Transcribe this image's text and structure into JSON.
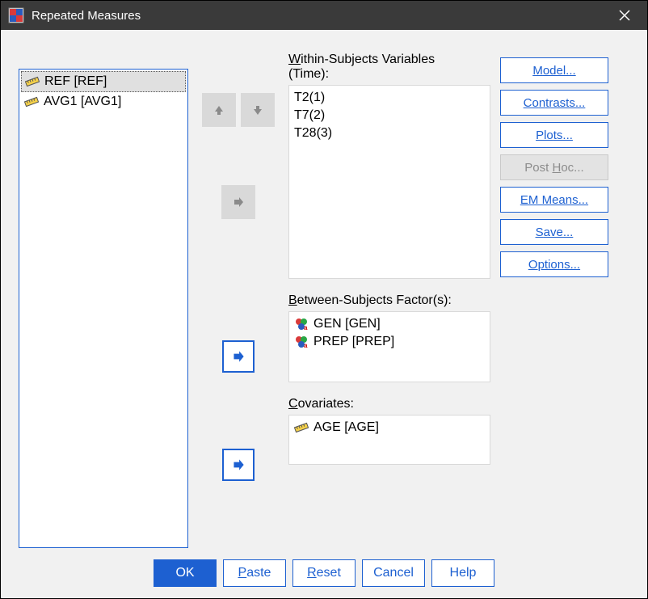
{
  "window": {
    "title": "Repeated Measures"
  },
  "sourceList": {
    "items": [
      {
        "label": "REF [REF]",
        "type": "scale",
        "selected": true
      },
      {
        "label": "AVG1   [AVG1]",
        "type": "scale",
        "selected": false
      }
    ]
  },
  "withinSubjects": {
    "label_prefix": "W",
    "label_rest": "ithin-Subjects Variables",
    "factorName": "(Time):",
    "items": [
      "T2(1)",
      "T7(2)",
      "T28(3)"
    ]
  },
  "betweenSubjects": {
    "label_prefix": "B",
    "label_rest": "etween-Subjects Factor(s):",
    "items": [
      {
        "label": "GEN [GEN]",
        "type": "nominal"
      },
      {
        "label": "PREP [PREP]",
        "type": "nominal"
      }
    ]
  },
  "covariates": {
    "label_prefix": "C",
    "label_rest": "ovariates:",
    "items": [
      {
        "label": "AGE   [AGE]",
        "type": "scale"
      }
    ]
  },
  "sideButtons": {
    "model": "Model...",
    "contrasts": "Contrasts...",
    "plots": "Plots...",
    "posthoc": "Post Hoc...",
    "emmeans": "EM Means...",
    "save": "Save...",
    "options": "Options..."
  },
  "bottomButtons": {
    "ok": "OK",
    "paste": "Paste",
    "reset": "Reset",
    "cancel": "Cancel",
    "help": "Help"
  }
}
